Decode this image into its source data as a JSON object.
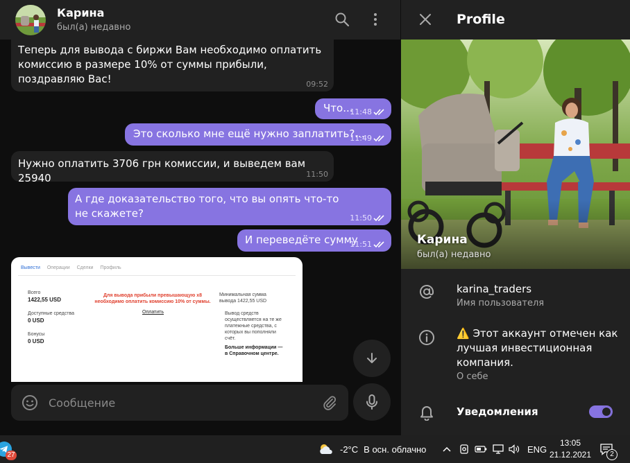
{
  "chat": {
    "name": "Карина",
    "status": "был(а) недавно",
    "messages": [
      {
        "dir": "in",
        "text": "Теперь для вывода с биржи Вам необходимо оплатить комиссию в размере 10% от суммы прибыли, поздравляю Вас!",
        "time": "09:52"
      },
      {
        "dir": "out",
        "text": "Что...",
        "time": "11:48"
      },
      {
        "dir": "out",
        "text": "Это сколько мне ещё нужно заплатить?...",
        "time": "11:49"
      },
      {
        "dir": "in",
        "text": "Нужно оплатить 3706 грн комиссии, и выведем вам 25940",
        "time": "11:50"
      },
      {
        "dir": "out",
        "text": "А где доказательство того, что вы опять что-то не скажете?",
        "time": "11:50"
      },
      {
        "dir": "out",
        "text": "И переведёте сумму",
        "time": "11:51"
      }
    ],
    "screenshot": {
      "tabs": [
        "Вывести",
        "Операции",
        "Сделки",
        "Профиль"
      ],
      "total_label": "Всего",
      "total_value": "1422,55 USD",
      "available_label": "Доступные средства",
      "available_value": "0 USD",
      "bonus_label": "Бонусы",
      "bonus_value": "0 USD",
      "warning": "Для вывода прибыли превышающую х8 необходимо оплатить комиссию 10% от суммы.",
      "pay_link": "Оплатить",
      "min_label": "Минимальная сумма вывода 1422,55 USD",
      "note": "Вывод средств осуществляется на те же платежные средства, с которых вы пополняли счёт.",
      "more_info": "Больше информации — в Справочном центре."
    },
    "composer_placeholder": "Сообщение"
  },
  "profile": {
    "title": "Profile",
    "name": "Карина",
    "status": "был(а) недавно",
    "username": "karina_traders",
    "username_label": "Имя пользователя",
    "bio": "⚠️ Этот аккаунт отмечен как лучшая инвестиционная компания.",
    "bio_label": "О себе",
    "notifications_label": "Уведомления",
    "notifications_on": true
  },
  "taskbar": {
    "telegram_badge": "27",
    "temperature": "-2°C",
    "weather": "В осн. облачно",
    "language": "ENG",
    "time": "13:05",
    "date": "21.12.2021",
    "notification_count": "2"
  },
  "colors": {
    "accent": "#8774e1",
    "panel": "#212121",
    "background": "#0e0e0e"
  }
}
